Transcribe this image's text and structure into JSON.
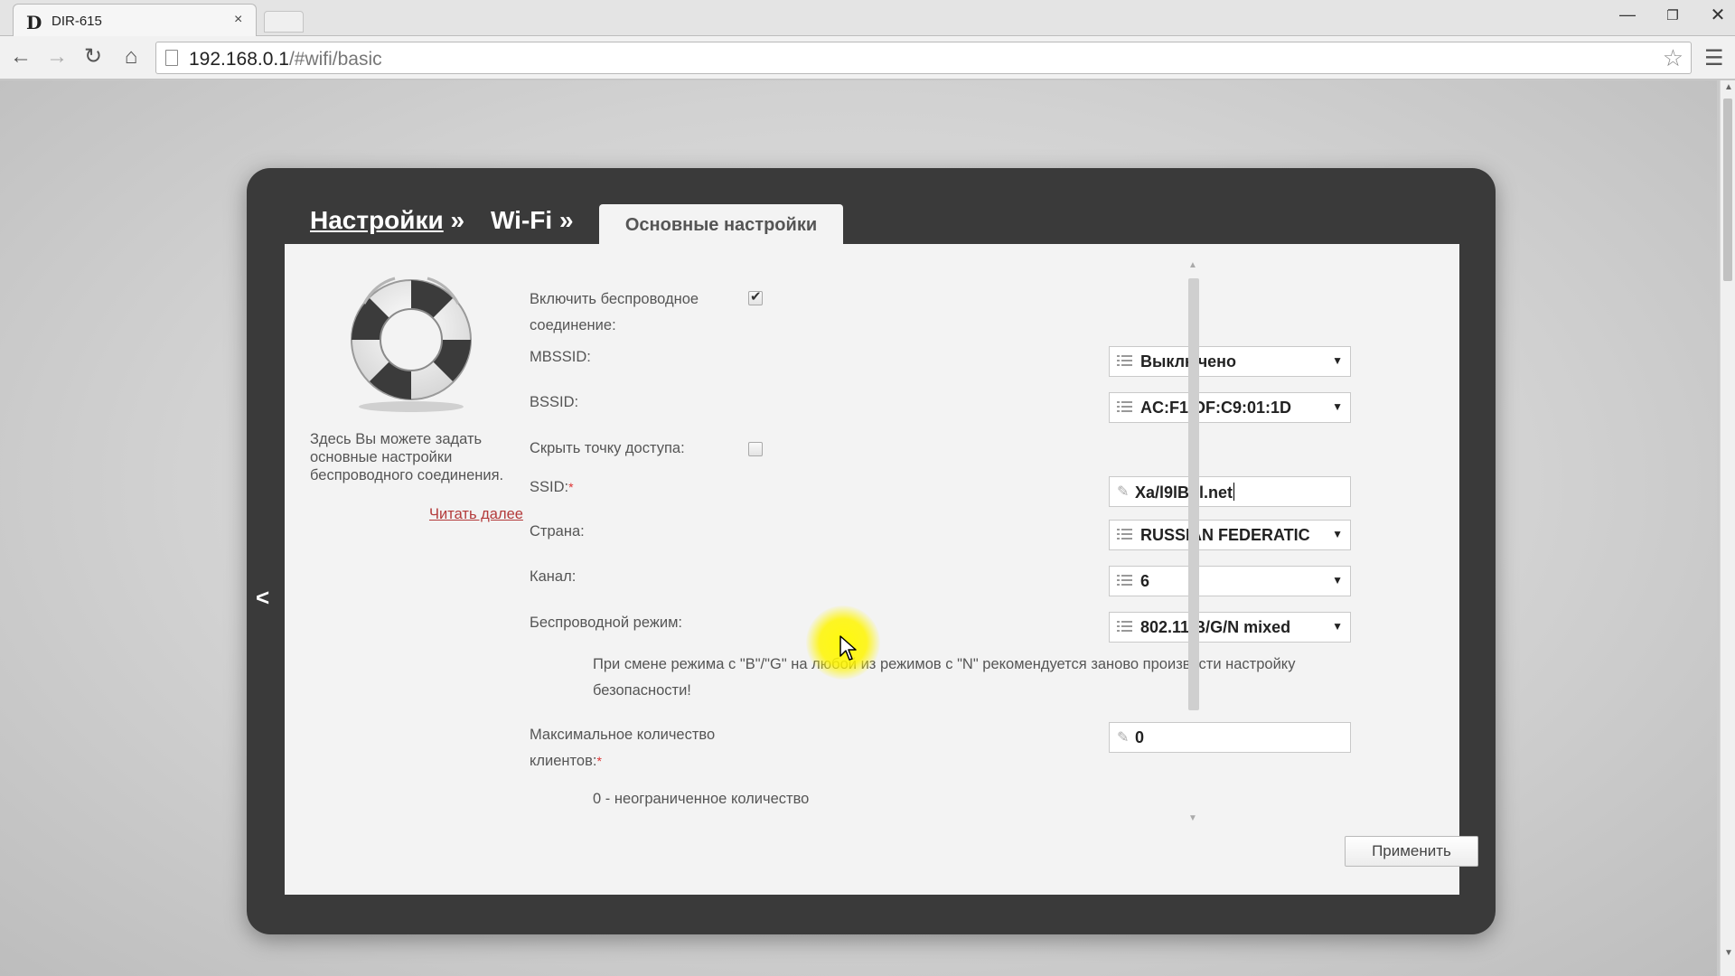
{
  "browser": {
    "tab_title": "DIR-615",
    "tab_favicon": "D",
    "tab_close": "×",
    "url_host": "192.168.0.1",
    "url_path": "/#wifi/basic"
  },
  "header": {
    "crumb_settings": "Настройки",
    "crumb_wifi": "Wi-Fi",
    "crumb_sep": "»",
    "active_tab": "Основные настройки"
  },
  "info": {
    "text": "Здесь Вы можете задать основные настройки беспроводного соединения.",
    "read_more": "Читать далее"
  },
  "form": {
    "enable_wireless": {
      "label": "Включить беспроводное соединение:",
      "checked": true
    },
    "mbssid": {
      "label": "MBSSID:",
      "value": "Выключено"
    },
    "bssid": {
      "label": "BSSID:",
      "value": "AC:F1:DF:C9:01:1D"
    },
    "hide_ap": {
      "label": "Скрыть точку доступа:",
      "checked": false
    },
    "ssid": {
      "label": "SSID:",
      "required_mark": "*",
      "value": "Xa/l9lBbl.net"
    },
    "country": {
      "label": "Страна:",
      "value": "RUSSIAN FEDERATIC"
    },
    "channel": {
      "label": "Канал:",
      "value": "6"
    },
    "wireless_mode": {
      "label": "Беспроводной режим:",
      "value": "802.11 B/G/N mixed",
      "note": "При смене режима с \"B\"/\"G\" на любой из режимов с \"N\" рекомендуется заново произвести настройку безопасности!"
    },
    "max_clients": {
      "label_line1": "Максимальное количество",
      "label_line2": "клиентов:",
      "required_mark": "*",
      "value": "0",
      "note": "0 - неограниченное количество"
    }
  },
  "actions": {
    "apply": "Применить"
  },
  "icons": {
    "back": "back-arrow-icon",
    "forward": "forward-arrow-icon",
    "reload": "reload-icon",
    "home": "home-icon",
    "bookmark": "star-icon",
    "menu": "hamburger-menu-icon",
    "help": "lifebuoy-icon",
    "collapse": "chevron-left-icon"
  }
}
